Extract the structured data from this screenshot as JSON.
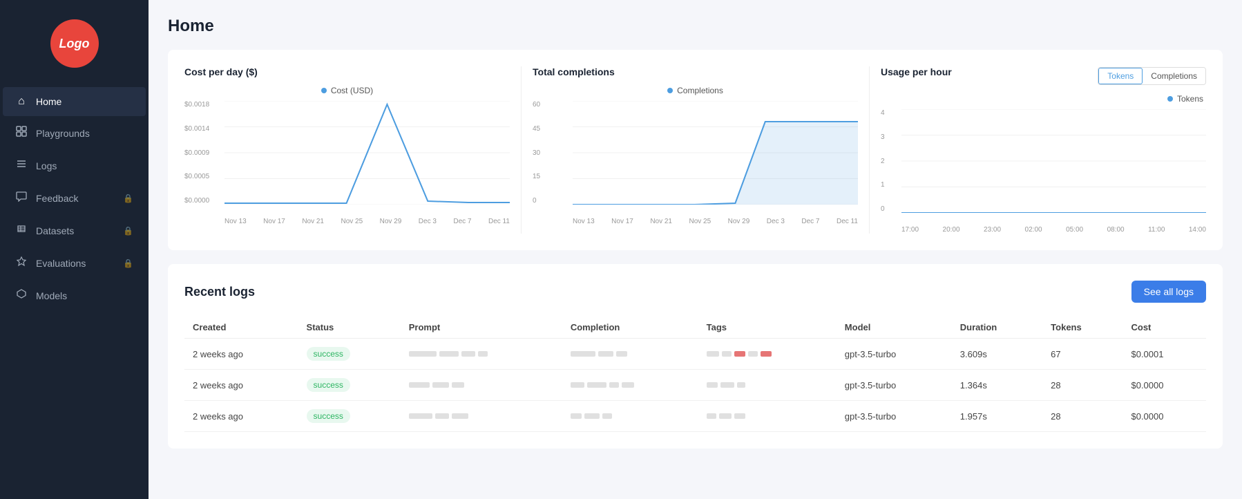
{
  "sidebar": {
    "logo_text": "Logo",
    "items": [
      {
        "id": "home",
        "label": "Home",
        "icon": "⌂",
        "active": true,
        "locked": false
      },
      {
        "id": "playgrounds",
        "label": "Playgrounds",
        "icon": "▦",
        "active": false,
        "locked": false
      },
      {
        "id": "logs",
        "label": "Logs",
        "icon": "≡",
        "active": false,
        "locked": false
      },
      {
        "id": "feedback",
        "label": "Feedback",
        "icon": "💬",
        "active": false,
        "locked": true
      },
      {
        "id": "datasets",
        "label": "Datasets",
        "icon": "📋",
        "active": false,
        "locked": true
      },
      {
        "id": "evaluations",
        "label": "Evaluations",
        "icon": "◇",
        "active": false,
        "locked": true
      },
      {
        "id": "models",
        "label": "Models",
        "icon": "⬡",
        "active": false,
        "locked": false
      }
    ]
  },
  "page": {
    "title": "Home"
  },
  "charts": {
    "cost_per_day": {
      "title": "Cost per day ($)",
      "legend": "Cost (USD)",
      "y_labels": [
        "$0.0018",
        "$0.0014",
        "$0.0009",
        "$0.0005",
        "$0.0000"
      ],
      "x_labels": [
        "Nov 13",
        "Nov 17",
        "Nov 21",
        "Nov 25",
        "Nov 29",
        "Dec 3",
        "Dec 7",
        "Dec 11"
      ]
    },
    "total_completions": {
      "title": "Total completions",
      "legend": "Completions",
      "y_labels": [
        "60",
        "45",
        "30",
        "15",
        "0"
      ],
      "x_labels": [
        "Nov 13",
        "Nov 17",
        "Nov 21",
        "Nov 25",
        "Nov 29",
        "Dec 3",
        "Dec 7",
        "Dec 11"
      ]
    },
    "usage_per_hour": {
      "title": "Usage per hour",
      "legend": "Tokens",
      "toggle_options": [
        "Tokens",
        "Completions"
      ],
      "active_toggle": "Tokens",
      "y_labels": [
        "4",
        "3",
        "2",
        "1",
        "0"
      ],
      "x_labels": [
        "17:00",
        "20:00",
        "23:00",
        "02:00",
        "05:00",
        "08:00",
        "11:00",
        "14:00"
      ]
    }
  },
  "recent_logs": {
    "title": "Recent logs",
    "see_all_label": "See all logs",
    "columns": [
      "Created",
      "Status",
      "Prompt",
      "Completion",
      "Tags",
      "Model",
      "Duration",
      "Tokens",
      "Cost"
    ],
    "rows": [
      {
        "created": "2 weeks ago",
        "status": "success",
        "model": "gpt-3.5-turbo",
        "duration": "3.609s",
        "tokens": "67",
        "cost": "$0.0001"
      },
      {
        "created": "2 weeks ago",
        "status": "success",
        "model": "gpt-3.5-turbo",
        "duration": "1.364s",
        "tokens": "28",
        "cost": "$0.0000"
      },
      {
        "created": "2 weeks ago",
        "status": "success",
        "model": "gpt-3.5-turbo",
        "duration": "1.957s",
        "tokens": "28",
        "cost": "$0.0000"
      }
    ]
  }
}
